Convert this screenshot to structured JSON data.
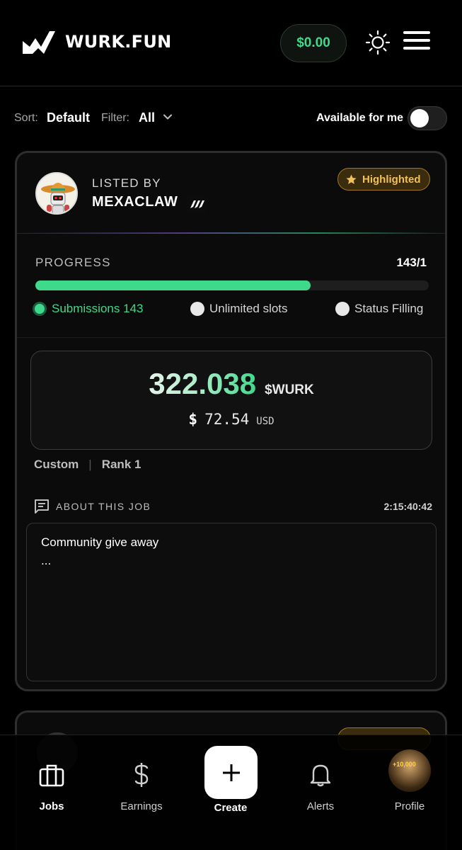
{
  "header": {
    "brand": "WURK.FUN",
    "balance": "$0.00"
  },
  "filters": {
    "sort_label": "Sort:",
    "sort_value": "Default",
    "filter_label": "Filter:",
    "filter_value": "All",
    "available_label": "Available for me",
    "available_on": false
  },
  "job": {
    "listed_by_label": "LISTED BY",
    "lister": "MEXACLAW",
    "badge": "Highlighted",
    "progress_label": "PROGRESS",
    "progress_count": "143/1",
    "progress_fraction": 0.7,
    "submissions": "Submissions 143",
    "slots": "Unlimited slots",
    "status": "Status Filling",
    "reward_amount": "322.038",
    "reward_token": "$WURK",
    "usd_sign": "$",
    "usd_value": "72.54",
    "usd_unit": "USD",
    "type": "Custom",
    "rank": "Rank 1",
    "about_label": "ABOUT THIS JOB",
    "timer": "2:15:40:42",
    "description_line1": "Community give away",
    "description_line2": "..."
  },
  "nav": {
    "jobs": "Jobs",
    "earnings": "Earnings",
    "create": "Create",
    "alerts": "Alerts",
    "profile": "Profile",
    "profile_gain": "+10,000"
  },
  "colors": {
    "accent_green": "#3fd98c",
    "badge_gold": "#f2c156",
    "background": "#000000"
  }
}
